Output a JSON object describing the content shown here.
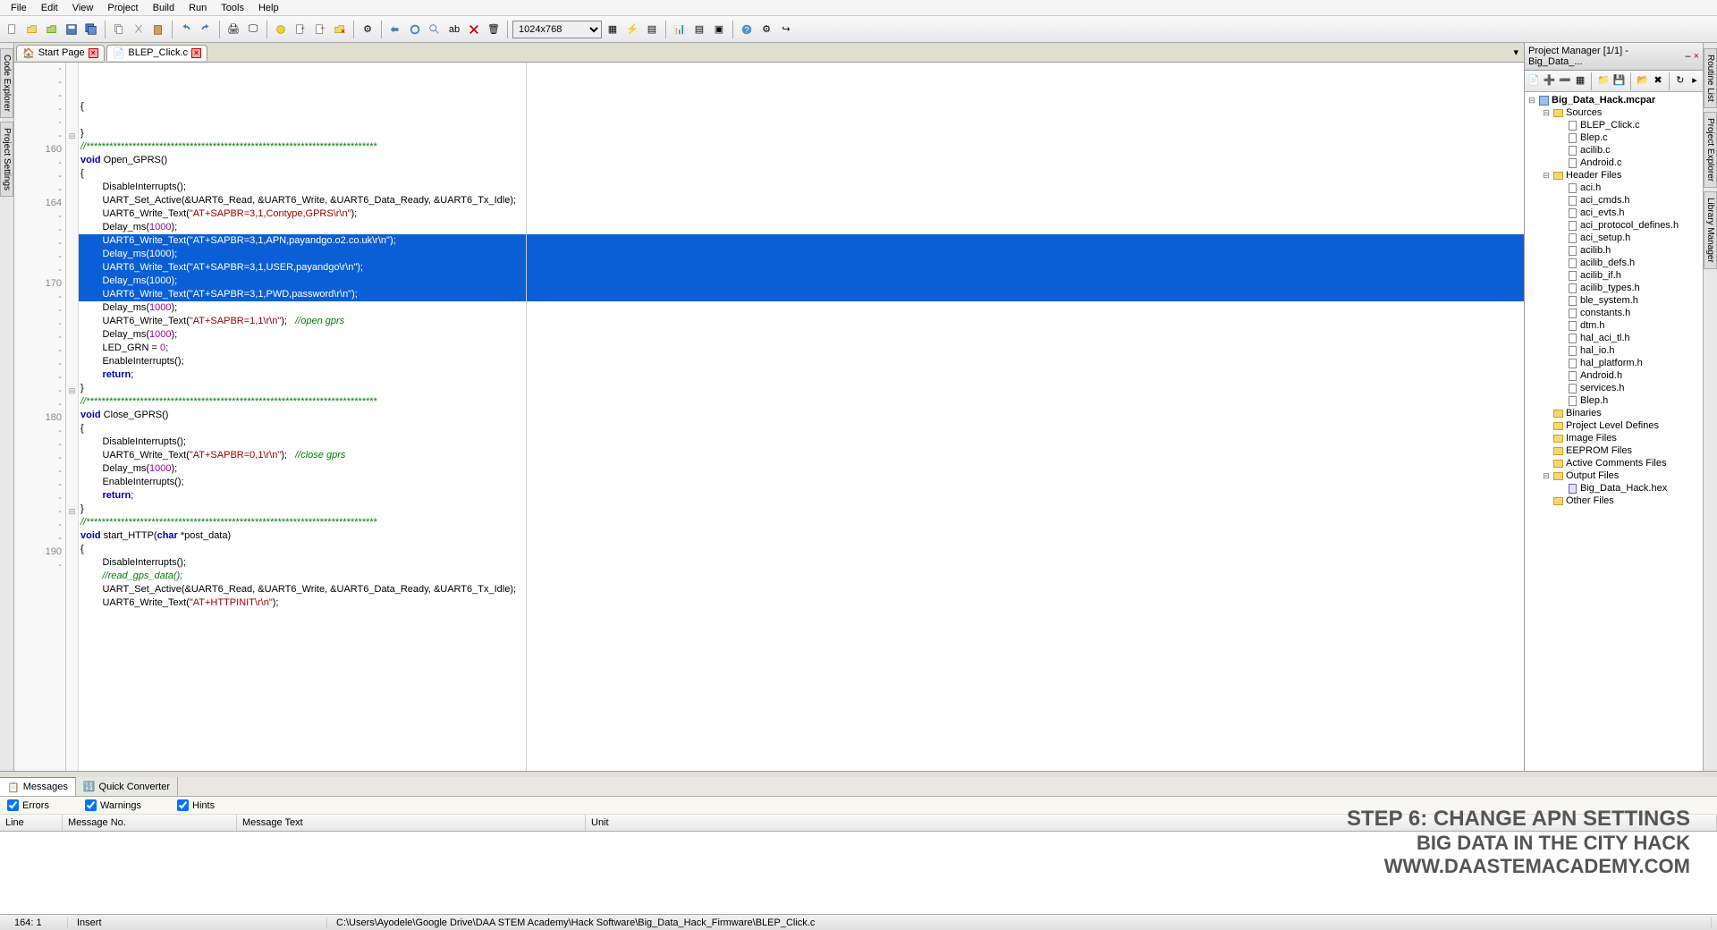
{
  "menu": [
    "File",
    "Edit",
    "View",
    "Project",
    "Build",
    "Run",
    "Tools",
    "Help"
  ],
  "toolbar": {
    "resolution": "1024x768"
  },
  "left_tabs": [
    "Code Explorer",
    "Project Settings"
  ],
  "right_tabs": [
    "Routine List",
    "Project Explorer",
    "Library Manager"
  ],
  "tabs": [
    {
      "label": "Start Page",
      "active": false
    },
    {
      "label": "BLEP_Click.c",
      "active": true
    }
  ],
  "code": {
    "lines": [
      {
        "num": "-",
        "fold": "",
        "text": "{",
        "indent": 0
      },
      {
        "num": "-",
        "fold": "",
        "text": "",
        "indent": 0
      },
      {
        "num": "-",
        "fold": "",
        "text": "}",
        "indent": 0
      },
      {
        "num": "-",
        "fold": "",
        "text": "//****************************************************************************",
        "indent": 0,
        "cmt": true
      },
      {
        "num": "-",
        "fold": "",
        "text": "void Open_GPRS()",
        "indent": 0,
        "kw": true
      },
      {
        "num": "-",
        "fold": "⊟",
        "text": "{",
        "indent": 0
      },
      {
        "num": "160",
        "fold": "",
        "text": "DisableInterrupts();",
        "indent": 2
      },
      {
        "num": "-",
        "fold": "",
        "text": "UART_Set_Active(&UART6_Read, &UART6_Write, &UART6_Data_Ready, &UART6_Tx_Idle);",
        "indent": 2
      },
      {
        "num": "-",
        "fold": "",
        "parts": [
          "UART6_Write_Text(",
          "\"AT+SAPBR=3,1,Contype,GPRS\\r\\n\"",
          ");"
        ],
        "indent": 2
      },
      {
        "num": "-",
        "fold": "",
        "parts": [
          "Delay_ms(",
          "1000",
          ");"
        ],
        "indent": 2,
        "numlit": true
      },
      {
        "num": "164",
        "fold": "",
        "sel": true,
        "parts": [
          "UART6_Write_Text(",
          "\"AT+SAPBR=3,1,APN,payandgo.o2.co.uk\\r\\n\"",
          ");"
        ],
        "indent": 2
      },
      {
        "num": "-",
        "fold": "",
        "sel": true,
        "parts": [
          "Delay_ms(",
          "1000",
          ");"
        ],
        "indent": 2,
        "numlit": true
      },
      {
        "num": "-",
        "fold": "",
        "sel": true,
        "parts": [
          "UART6_Write_Text(",
          "\"AT+SAPBR=3,1,USER,payandgo\\r\\n\"",
          ");"
        ],
        "indent": 2
      },
      {
        "num": "-",
        "fold": "",
        "sel": true,
        "parts": [
          "Delay_ms(",
          "1000",
          ");"
        ],
        "indent": 2,
        "numlit": true
      },
      {
        "num": "-",
        "fold": "",
        "sel": true,
        "parts": [
          "UART6_Write_Text(",
          "\"AT+SAPBR=3,1,PWD,password\\r\\n\"",
          ");"
        ],
        "indent": 2
      },
      {
        "num": "-",
        "fold": "",
        "parts": [
          "Delay_ms(",
          "1000",
          ");"
        ],
        "indent": 2,
        "numlit": true
      },
      {
        "num": "170",
        "fold": "",
        "parts": [
          "UART6_Write_Text(",
          "\"AT+SAPBR=1,1\\r\\n\"",
          ");   ",
          "//open gprs"
        ],
        "indent": 2
      },
      {
        "num": "-",
        "fold": "",
        "parts": [
          "Delay_ms(",
          "1000",
          ");"
        ],
        "indent": 2,
        "numlit": true
      },
      {
        "num": "-",
        "fold": "",
        "parts": [
          "LED_GRN = ",
          "0",
          ";"
        ],
        "indent": 2,
        "numlit": true
      },
      {
        "num": "-",
        "fold": "",
        "text": "EnableInterrupts();",
        "indent": 2
      },
      {
        "num": "-",
        "fold": "",
        "text": "return;",
        "indent": 2,
        "kw": true
      },
      {
        "num": "-",
        "fold": "",
        "text": "}",
        "indent": 0
      },
      {
        "num": "-",
        "fold": "",
        "text": "//****************************************************************************",
        "indent": 0,
        "cmt": true
      },
      {
        "num": "-",
        "fold": "",
        "text": "void Close_GPRS()",
        "indent": 0,
        "kw": true
      },
      {
        "num": "-",
        "fold": "⊟",
        "text": "{",
        "indent": 0
      },
      {
        "num": "-",
        "fold": "",
        "text": "DisableInterrupts();",
        "indent": 2
      },
      {
        "num": "180",
        "fold": "",
        "parts": [
          "UART6_Write_Text(",
          "\"AT+SAPBR=0,1\\r\\n\"",
          ");   ",
          "//close gprs"
        ],
        "indent": 2
      },
      {
        "num": "-",
        "fold": "",
        "parts": [
          "Delay_ms(",
          "1000",
          ");"
        ],
        "indent": 2,
        "numlit": true
      },
      {
        "num": "-",
        "fold": "",
        "text": "EnableInterrupts();",
        "indent": 2
      },
      {
        "num": "-",
        "fold": "",
        "text": "return;",
        "indent": 2,
        "kw": true
      },
      {
        "num": "-",
        "fold": "",
        "text": "}",
        "indent": 0
      },
      {
        "num": "-",
        "fold": "",
        "text": "//****************************************************************************",
        "indent": 0,
        "cmt": true
      },
      {
        "num": "-",
        "fold": "",
        "text": "void start_HTTP(char *post_data)",
        "indent": 0,
        "kw": true
      },
      {
        "num": "-",
        "fold": "⊟",
        "text": "{",
        "indent": 0
      },
      {
        "num": "-",
        "fold": "",
        "text": "DisableInterrupts();",
        "indent": 2
      },
      {
        "num": "-",
        "fold": "",
        "text": "//read_gps_data();",
        "indent": 2,
        "cmt": true
      },
      {
        "num": "190",
        "fold": "",
        "text": "UART_Set_Active(&UART6_Read, &UART6_Write, &UART6_Data_Ready, &UART6_Tx_Idle);",
        "indent": 2
      },
      {
        "num": "-",
        "fold": "",
        "parts": [
          "UART6_Write_Text(",
          "\"AT+HTTPINIT\\r\\n\"",
          ");"
        ],
        "indent": 2
      }
    ]
  },
  "project": {
    "title": "Project Manager [1/1] - Big_Data_...",
    "root": "Big_Data_Hack.mcpar",
    "tree": [
      {
        "label": "Sources",
        "type": "folder",
        "depth": 1,
        "open": true
      },
      {
        "label": "BLEP_Click.c",
        "type": "file",
        "depth": 2
      },
      {
        "label": "Blep.c",
        "type": "file",
        "depth": 2
      },
      {
        "label": "acilib.c",
        "type": "file",
        "depth": 2
      },
      {
        "label": "Android.c",
        "type": "file",
        "depth": 2
      },
      {
        "label": "Header Files",
        "type": "folder",
        "depth": 1,
        "open": true
      },
      {
        "label": "aci.h",
        "type": "file",
        "depth": 2
      },
      {
        "label": "aci_cmds.h",
        "type": "file",
        "depth": 2
      },
      {
        "label": "aci_evts.h",
        "type": "file",
        "depth": 2
      },
      {
        "label": "aci_protocol_defines.h",
        "type": "file",
        "depth": 2
      },
      {
        "label": "aci_setup.h",
        "type": "file",
        "depth": 2
      },
      {
        "label": "acilib.h",
        "type": "file",
        "depth": 2
      },
      {
        "label": "acilib_defs.h",
        "type": "file",
        "depth": 2
      },
      {
        "label": "acilib_if.h",
        "type": "file",
        "depth": 2
      },
      {
        "label": "acilib_types.h",
        "type": "file",
        "depth": 2
      },
      {
        "label": "ble_system.h",
        "type": "file",
        "depth": 2
      },
      {
        "label": "constants.h",
        "type": "file",
        "depth": 2
      },
      {
        "label": "dtm.h",
        "type": "file",
        "depth": 2
      },
      {
        "label": "hal_aci_tl.h",
        "type": "file",
        "depth": 2
      },
      {
        "label": "hal_io.h",
        "type": "file",
        "depth": 2
      },
      {
        "label": "hal_platform.h",
        "type": "file",
        "depth": 2
      },
      {
        "label": "Android.h",
        "type": "file",
        "depth": 2
      },
      {
        "label": "services.h",
        "type": "file",
        "depth": 2
      },
      {
        "label": "Blep.h",
        "type": "file",
        "depth": 2
      },
      {
        "label": "Binaries",
        "type": "folder",
        "depth": 1
      },
      {
        "label": "Project Level Defines",
        "type": "folder",
        "depth": 1
      },
      {
        "label": "Image Files",
        "type": "folder",
        "depth": 1
      },
      {
        "label": "EEPROM Files",
        "type": "folder",
        "depth": 1
      },
      {
        "label": "Active Comments Files",
        "type": "folder",
        "depth": 1
      },
      {
        "label": "Output Files",
        "type": "folder",
        "depth": 1,
        "open": true
      },
      {
        "label": "Big_Data_Hack.hex",
        "type": "hex",
        "depth": 2
      },
      {
        "label": "Other Files",
        "type": "folder",
        "depth": 1
      }
    ]
  },
  "messages": {
    "tabs": [
      "Messages",
      "Quick Converter"
    ],
    "filters": {
      "errors": "Errors",
      "warnings": "Warnings",
      "hints": "Hints"
    },
    "cols": {
      "line": "Line",
      "msgno": "Message No.",
      "text": "Message Text",
      "unit": "Unit"
    }
  },
  "status": {
    "pos": "164: 1",
    "mode": "Insert",
    "path": "C:\\Users\\Ayodele\\Google Drive\\DAA STEM Academy\\Hack Software\\Big_Data_Hack_Firmware\\BLEP_Click.c"
  },
  "overlay": {
    "l1": "STEP 6: CHANGE APN SETTINGS",
    "l2": "BIG DATA IN THE CITY HACK",
    "l3": "WWW.DAASTEMACADEMY.COM"
  }
}
